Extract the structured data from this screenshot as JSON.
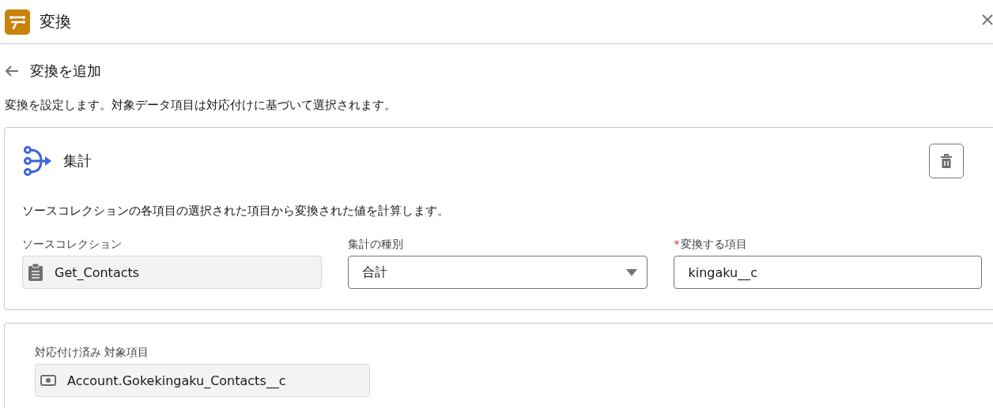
{
  "window": {
    "title": "変換"
  },
  "page": {
    "title": "変換を追加",
    "description": "変換を設定します。対象データ項目は対応付けに基づいて選択されます。"
  },
  "transform_card": {
    "title": "集計",
    "description": "ソースコレクションの各項目の選択された項目から変換された値を計算します。",
    "fields": [
      {
        "kind": "readonly",
        "label": "ソースコレクション",
        "value": "Get_Contacts",
        "required": false
      },
      {
        "kind": "select",
        "label": "集計の種別",
        "value": "合計",
        "required": false
      },
      {
        "kind": "input",
        "label": "変換する項目",
        "value": "kingaku__c",
        "required": true,
        "required_mark": "*"
      }
    ]
  },
  "mapping_card": {
    "fields": [
      {
        "kind": "readonly",
        "label": "対応付け済み 対象項目",
        "value": "Account.Gokekingaku_Contacts__c",
        "required": false
      }
    ]
  }
}
